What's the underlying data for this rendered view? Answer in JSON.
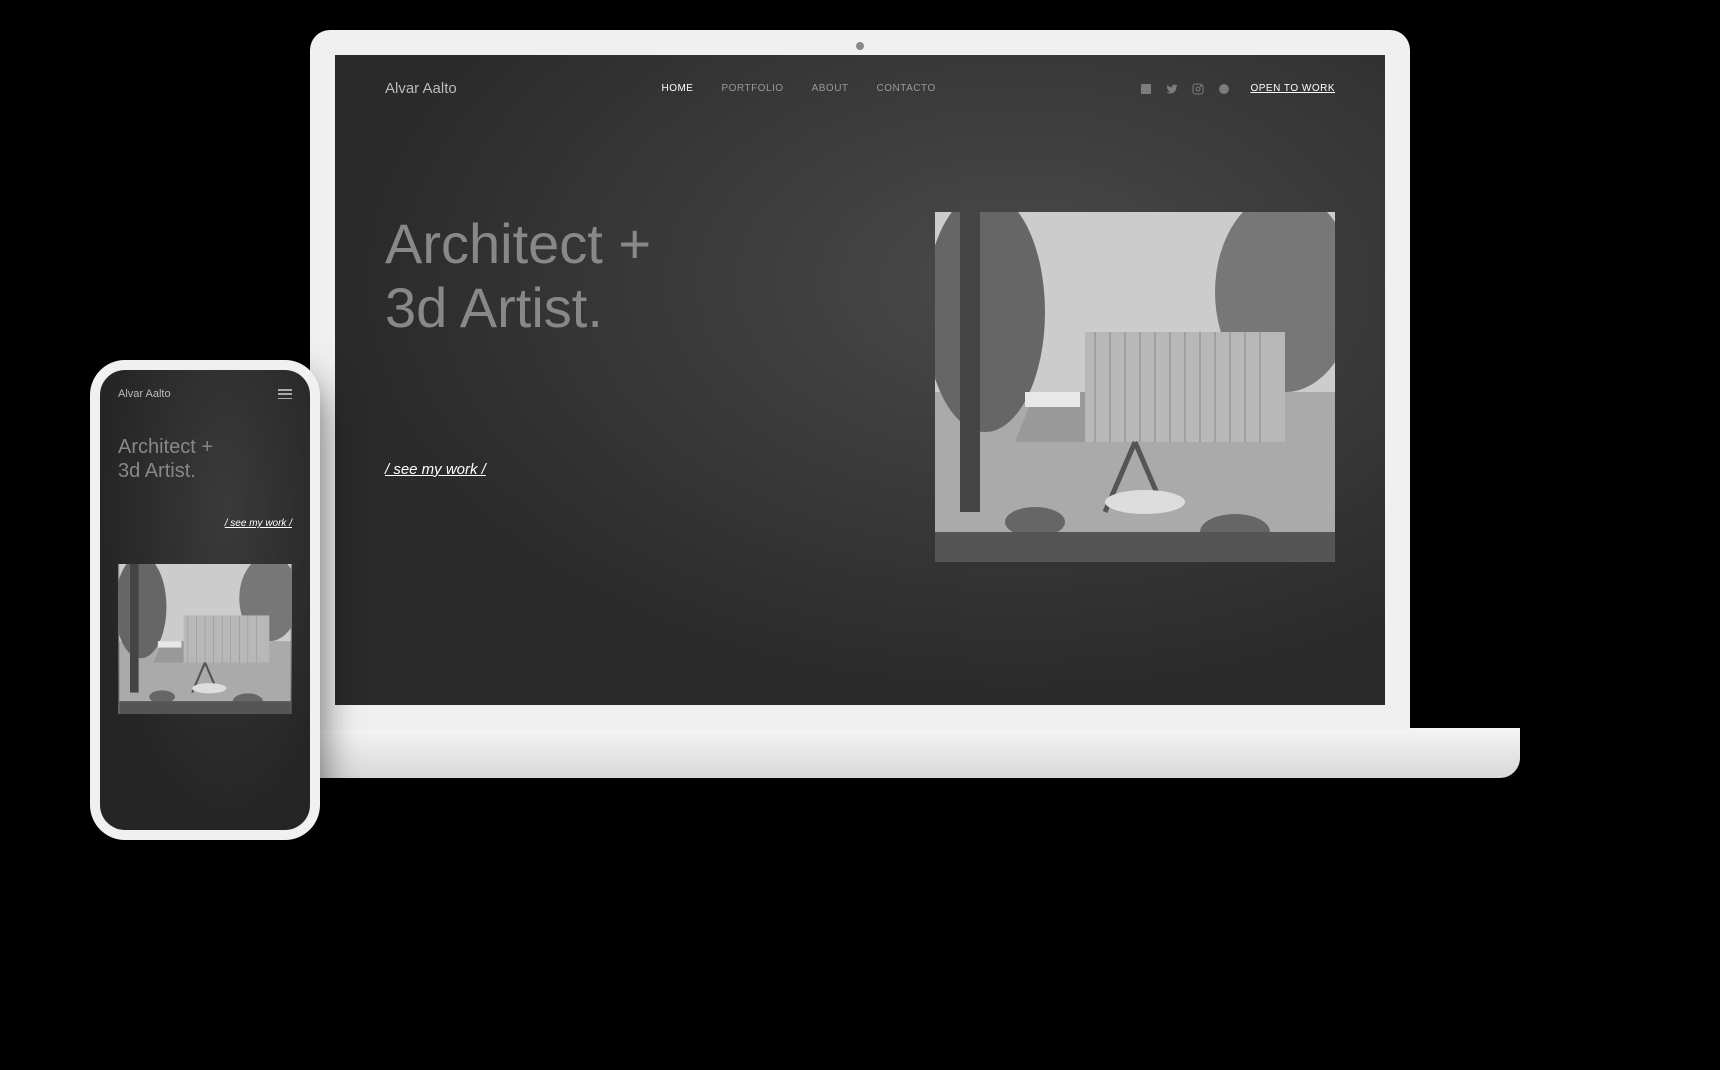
{
  "site": {
    "logo": "Alvar Aalto",
    "nav": [
      {
        "label": "HOME",
        "active": true
      },
      {
        "label": "PORTFOLIO",
        "active": false
      },
      {
        "label": "ABOUT",
        "active": false
      },
      {
        "label": "CONTACTO",
        "active": false
      }
    ],
    "social_icons": [
      "linkedin",
      "twitter",
      "instagram",
      "pinterest"
    ],
    "cta": "OPEN TO WORK",
    "hero": {
      "title_line1": "Architect +",
      "title_line2": "3d Artist.",
      "see_work": "/ see my work /"
    }
  },
  "mobile": {
    "logo": "Alvar Aalto",
    "hero": {
      "title_line1": "Architect +",
      "title_line2": "3d Artist.",
      "see_work": "/ see my work /"
    }
  }
}
